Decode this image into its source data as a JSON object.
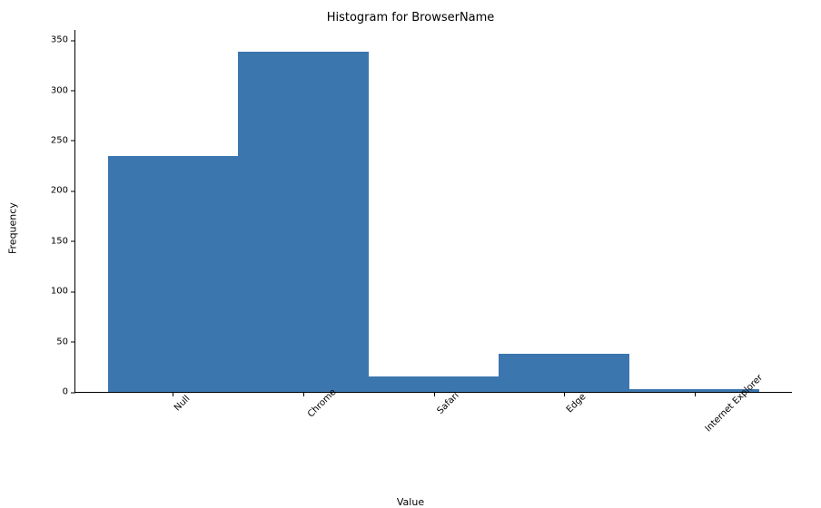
{
  "chart_data": {
    "type": "bar",
    "title": "Histogram for BrowserName",
    "xlabel": "Value",
    "ylabel": "Frequency",
    "categories": [
      "Null",
      "Chrome",
      "Safari",
      "Edge",
      "Internet Explorer"
    ],
    "values": [
      235,
      338,
      15,
      38,
      3
    ],
    "ylim": [
      0,
      360
    ],
    "yticks": [
      0,
      50,
      100,
      150,
      200,
      250,
      300,
      350
    ],
    "bar_color": "#3c76af"
  }
}
